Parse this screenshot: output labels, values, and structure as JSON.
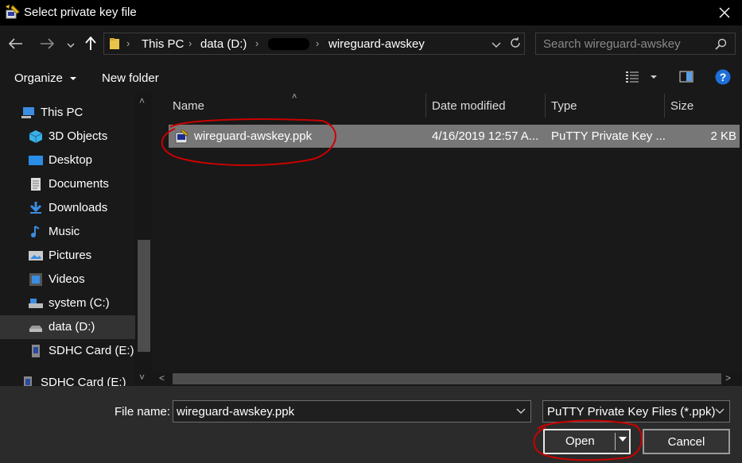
{
  "window": {
    "title": "Select private key file"
  },
  "address": {
    "crumbs": [
      "This PC",
      "data (D:)",
      "wireguard-awskey"
    ]
  },
  "search": {
    "placeholder": "Search wireguard-awskey"
  },
  "toolbar": {
    "organize": "Organize",
    "new_folder": "New folder"
  },
  "sidebar": {
    "items": [
      {
        "label": "This PC",
        "icon": "computer-icon"
      },
      {
        "label": "3D Objects",
        "icon": "cube-icon"
      },
      {
        "label": "Desktop",
        "icon": "desktop-icon"
      },
      {
        "label": "Documents",
        "icon": "document-icon"
      },
      {
        "label": "Downloads",
        "icon": "download-icon"
      },
      {
        "label": "Music",
        "icon": "music-icon"
      },
      {
        "label": "Pictures",
        "icon": "picture-icon"
      },
      {
        "label": "Videos",
        "icon": "video-icon"
      },
      {
        "label": "system (C:)",
        "icon": "drive-icon"
      },
      {
        "label": "data (D:)",
        "icon": "drive-icon"
      },
      {
        "label": "SDHC Card (E:)",
        "icon": "sdcard-icon"
      },
      {
        "label": "SDHC Card (E:)",
        "icon": "sdcard-icon"
      }
    ]
  },
  "columns": {
    "name": "Name",
    "date": "Date modified",
    "type": "Type",
    "size": "Size"
  },
  "files": [
    {
      "name": "wireguard-awskey.ppk",
      "date": "4/16/2019 12:57 A...",
      "type": "PuTTY Private Key ...",
      "size": "2 KB"
    }
  ],
  "footer": {
    "file_name_label": "File name:",
    "file_name_value": "wireguard-awskey.ppk",
    "file_type": "PuTTY Private Key Files (*.ppk)",
    "open_label": "Open",
    "cancel_label": "Cancel"
  },
  "colors": {
    "background": "#191919",
    "selected_row": "#777777",
    "annotation": "#cc0000",
    "help": "#1e6fd9"
  }
}
